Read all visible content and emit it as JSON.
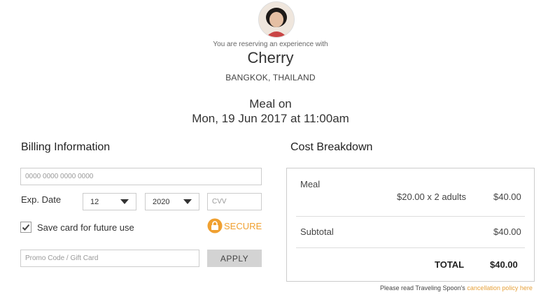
{
  "header": {
    "intro": "You are reserving an experience with",
    "host_name": "Cherry",
    "location": "BANGKOK, THAILAND",
    "meal_title": "Meal on",
    "meal_datetime": "Mon, 19 Jun 2017 at 11:00am"
  },
  "billing": {
    "title": "Billing Information",
    "card_number_placeholder": "0000 0000 0000 0000",
    "exp_label": "Exp. Date",
    "exp_month": "12",
    "exp_year": "2020",
    "cvv_placeholder": "CVV",
    "save_card_label": "Save card for future use",
    "save_card_checked": true,
    "secure_badge": "SECURE",
    "promo_placeholder": "Promo Code / Gift Card",
    "apply_label": "APPLY"
  },
  "cost": {
    "title": "Cost Breakdown",
    "item_label": "Meal",
    "item_calc": "$20.00 x 2 adults",
    "item_amount": "$40.00",
    "subtotal_label": "Subtotal",
    "subtotal_amount": "$40.00",
    "total_label": "TOTAL",
    "total_amount": "$40.00"
  },
  "footer": {
    "note_prefix": "Please read Traveling Spoon's",
    "policy_link": "cancellation policy here"
  },
  "colors": {
    "link": "#e7a13a",
    "secure_badge": "#f0a030",
    "apply_bg": "#d3d3d3"
  }
}
